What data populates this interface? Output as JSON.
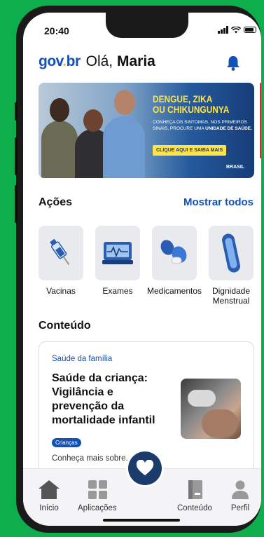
{
  "status": {
    "time": "20:40"
  },
  "header": {
    "logo_gov": "gov",
    "logo_dot": ".",
    "logo_br": "br",
    "greeting": "Olá,",
    "user_name": "Maria"
  },
  "banner": {
    "title_line1": "DENGUE, ZIKA",
    "title_line2": "OU CHIKUNGUNYA",
    "text_line1": "CONHEÇA OS SINTOMAS. NOS PRIMEIROS",
    "text_line2": "SINAIS, PROCURE UMA",
    "text_bold": "UNIDADE DE SAÚDE.",
    "cta": "CLIQUE AQUI E SAIBA MAIS",
    "brand": "BRASIL"
  },
  "actions": {
    "title": "Ações",
    "show_all": "Mostrar todos",
    "items": [
      {
        "label": "Vacinas",
        "icon": "vaccine-icon"
      },
      {
        "label": "Exames",
        "icon": "exam-monitor-icon"
      },
      {
        "label": "Medicamentos",
        "icon": "medicine-pills-icon"
      },
      {
        "label": "Dignidade\nMenstrual",
        "label_line1": "Dignidade",
        "label_line2": "Menstrual",
        "icon": "sanitary-pad-icon"
      }
    ]
  },
  "content": {
    "title": "Conteúdo",
    "card": {
      "category": "Saúde da família",
      "title": "Saúde da criança: Vigilância e prevenção da mortalidade infantil",
      "tag": "Crianças",
      "more": "Conheça mais sobre... Pijo"
    }
  },
  "tabbar": {
    "items": [
      {
        "label": "Início",
        "icon": "home-icon"
      },
      {
        "label": "Aplicações",
        "icon": "apps-grid-icon"
      },
      {
        "label": "Conteúdo",
        "icon": "content-book-icon"
      },
      {
        "label": "Perfil",
        "icon": "profile-icon"
      }
    ],
    "fab_icon": "heart-icon"
  },
  "colors": {
    "accent": "#1351b4",
    "background": "#0fae4c",
    "fab": "#1a3b6c"
  }
}
